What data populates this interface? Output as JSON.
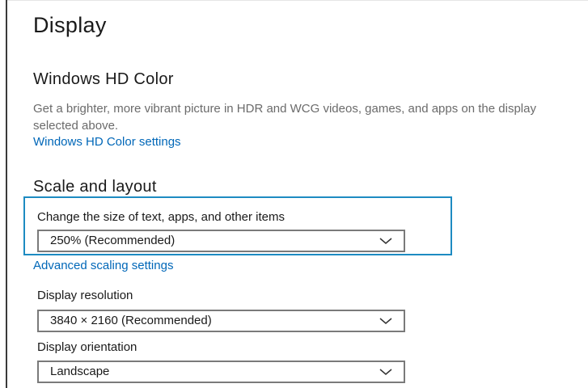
{
  "page": {
    "title": "Display"
  },
  "hd_color": {
    "heading": "Windows HD Color",
    "description": "Get a brighter, more vibrant picture in HDR and WCG videos, games, and apps on the display selected above.",
    "link": "Windows HD Color settings"
  },
  "scale_layout": {
    "heading": "Scale and layout",
    "scale_label": "Change the size of text, apps, and other items",
    "scale_value": "250% (Recommended)",
    "advanced_link": "Advanced scaling settings",
    "resolution_label": "Display resolution",
    "resolution_value": "3840 × 2160 (Recommended)",
    "orientation_label": "Display orientation",
    "orientation_value": "Landscape"
  },
  "icons": {
    "dropdown": "chevron-down-icon"
  },
  "colors": {
    "link": "#0067b8",
    "highlight": "#1d8bc2",
    "dropdown_border": "#7a7a7a",
    "description": "#6b6b6b"
  }
}
